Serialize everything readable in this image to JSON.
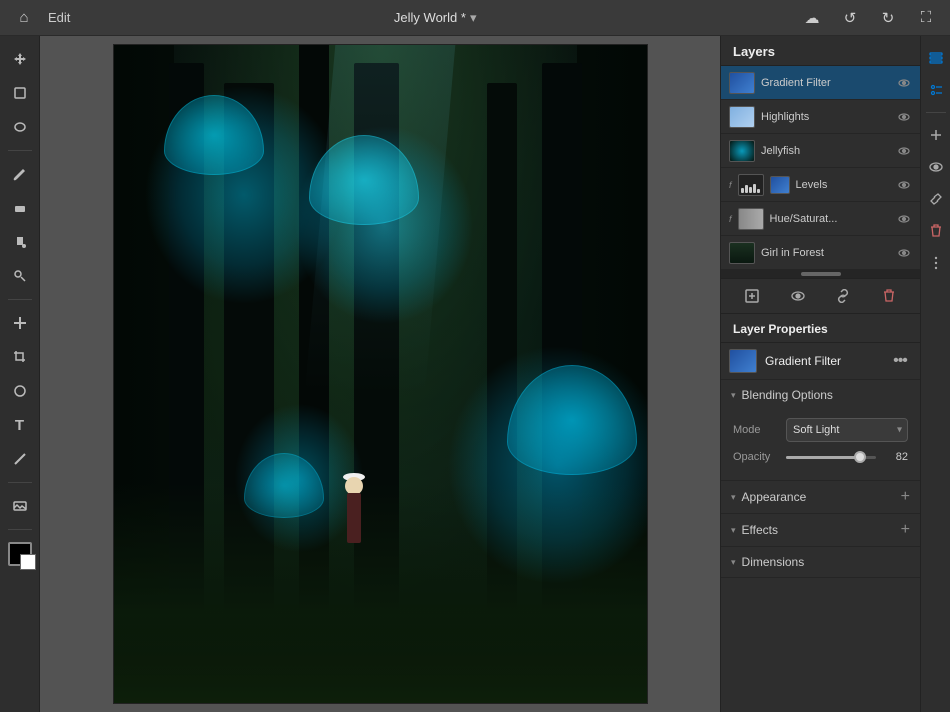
{
  "topBar": {
    "editLabel": "Edit",
    "projectTitle": "Jelly World *",
    "dropdownIcon": "▾",
    "cloudIcon": "☁",
    "undoIcon": "↺",
    "redoIcon": "↻",
    "fullscreenIcon": "⛶"
  },
  "leftTools": [
    {
      "name": "home-tool",
      "icon": "⌂"
    },
    {
      "name": "move-tool",
      "icon": "✛"
    },
    {
      "name": "lasso-tool",
      "icon": "○"
    },
    {
      "name": "brush-tool",
      "icon": "✏"
    },
    {
      "name": "eraser-tool",
      "icon": "◻"
    },
    {
      "name": "fill-tool",
      "icon": "◆"
    },
    {
      "name": "clone-tool",
      "icon": "⎘"
    },
    {
      "name": "healing-tool",
      "icon": "✦"
    },
    {
      "name": "crop-tool",
      "icon": "⌗"
    },
    {
      "name": "shape-tool",
      "icon": "◎"
    },
    {
      "name": "text-tool",
      "icon": "T"
    },
    {
      "name": "line-tool",
      "icon": "╱"
    },
    {
      "name": "image-tool",
      "icon": "▭"
    },
    {
      "name": "color-fg",
      "icon": ""
    },
    {
      "name": "color-bg",
      "icon": ""
    }
  ],
  "layers": {
    "title": "Layers",
    "items": [
      {
        "id": "gradient-filter",
        "name": "Gradient Filter",
        "type": "blue",
        "selected": true,
        "visible": true
      },
      {
        "id": "highlights",
        "name": "Highlights",
        "type": "light-blue",
        "selected": false,
        "visible": true
      },
      {
        "id": "jellyfish",
        "name": "Jellyfish",
        "type": "jellyfish",
        "selected": false,
        "visible": true
      },
      {
        "id": "levels",
        "name": "Levels",
        "type": "levels",
        "selected": false,
        "visible": true,
        "hasFx": true
      },
      {
        "id": "hue-saturation",
        "name": "Hue/Saturat...",
        "type": "hue",
        "selected": false,
        "visible": true,
        "hasFx": true
      },
      {
        "id": "girl-in-forest",
        "name": "Girl in Forest",
        "type": "forest",
        "selected": false,
        "visible": true
      }
    ]
  },
  "layerProperties": {
    "title": "Layer Properties",
    "activeName": "Gradient Filter",
    "moreIcon": "•••",
    "sections": {
      "blendingOptions": {
        "label": "Blending Options",
        "modeLabel": "Mode",
        "modeValue": "Soft Light",
        "opacityLabel": "Opacity",
        "opacityValue": "82",
        "opacityPercent": 82
      },
      "appearance": {
        "label": "Appearance",
        "addIcon": "+"
      },
      "effects": {
        "label": "Effects",
        "addIcon": "+"
      },
      "dimensions": {
        "label": "Dimensions"
      }
    }
  },
  "panelActions": {
    "addIcon": "+",
    "eyeIcon": "👁",
    "linkIcon": "⛓",
    "deleteIcon": "🗑"
  }
}
